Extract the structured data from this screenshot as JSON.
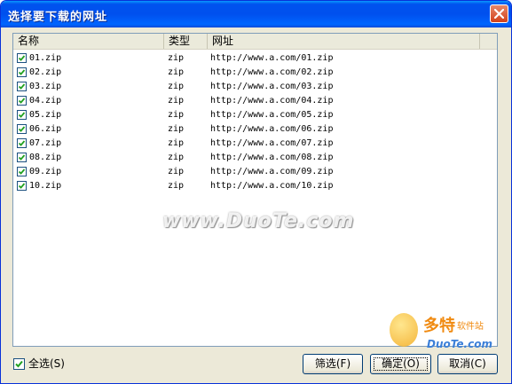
{
  "window": {
    "title": "选择要下载的网址"
  },
  "list": {
    "columns": [
      "名称",
      "类型",
      "网址"
    ],
    "rows": [
      {
        "checked": true,
        "name": "01.zip",
        "type": "zip",
        "url": "http://www.a.com/01.zip"
      },
      {
        "checked": true,
        "name": "02.zip",
        "type": "zip",
        "url": "http://www.a.com/02.zip"
      },
      {
        "checked": true,
        "name": "03.zip",
        "type": "zip",
        "url": "http://www.a.com/03.zip"
      },
      {
        "checked": true,
        "name": "04.zip",
        "type": "zip",
        "url": "http://www.a.com/04.zip"
      },
      {
        "checked": true,
        "name": "05.zip",
        "type": "zip",
        "url": "http://www.a.com/05.zip"
      },
      {
        "checked": true,
        "name": "06.zip",
        "type": "zip",
        "url": "http://www.a.com/06.zip"
      },
      {
        "checked": true,
        "name": "07.zip",
        "type": "zip",
        "url": "http://www.a.com/07.zip"
      },
      {
        "checked": true,
        "name": "08.zip",
        "type": "zip",
        "url": "http://www.a.com/08.zip"
      },
      {
        "checked": true,
        "name": "09.zip",
        "type": "zip",
        "url": "http://www.a.com/09.zip"
      },
      {
        "checked": true,
        "name": "10.zip",
        "type": "zip",
        "url": "http://www.a.com/10.zip"
      }
    ]
  },
  "footer": {
    "select_all": {
      "checked": true,
      "label": "全选(S)"
    },
    "filter_label": "筛选(F)",
    "ok_label": "确定(O)",
    "cancel_label": "取消(C)"
  },
  "watermark": {
    "text": "www.DuoTe.com"
  },
  "logo": {
    "cn": "多特",
    "sub": "软件站",
    "en": "DuoTe.com"
  },
  "colors": {
    "title_bar": "#0053ee",
    "close_button": "#d2411a",
    "dialog_bg": "#ece9d8"
  }
}
